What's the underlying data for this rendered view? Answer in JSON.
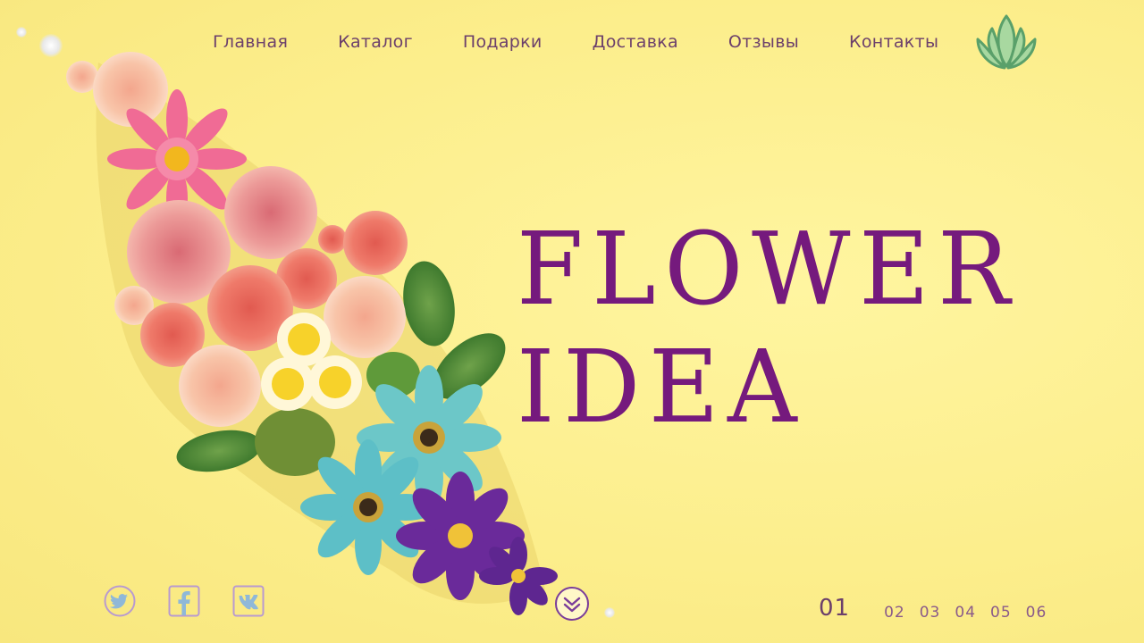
{
  "nav": {
    "items": [
      {
        "label": "Главная"
      },
      {
        "label": "Каталог"
      },
      {
        "label": "Подарки"
      },
      {
        "label": "Доставка"
      },
      {
        "label": "Отзывы"
      },
      {
        "label": "Контакты"
      }
    ]
  },
  "logo": {
    "icon": "lotus-icon",
    "color": "#a8d8a0",
    "stroke": "#5aa06a"
  },
  "hero": {
    "line1": "FLOWER",
    "line2": "IDEA",
    "color": "#751a7d"
  },
  "social": [
    {
      "icon": "twitter-icon"
    },
    {
      "icon": "facebook-icon"
    },
    {
      "icon": "vk-icon"
    }
  ],
  "scroll": {
    "icon": "chevron-down-icon"
  },
  "pager": {
    "active": "01",
    "pages": [
      "02",
      "03",
      "04",
      "05",
      "06"
    ]
  },
  "colors": {
    "background": "#fdf08f",
    "accent": "#751a7d",
    "nav_text": "#6b3f6b"
  }
}
